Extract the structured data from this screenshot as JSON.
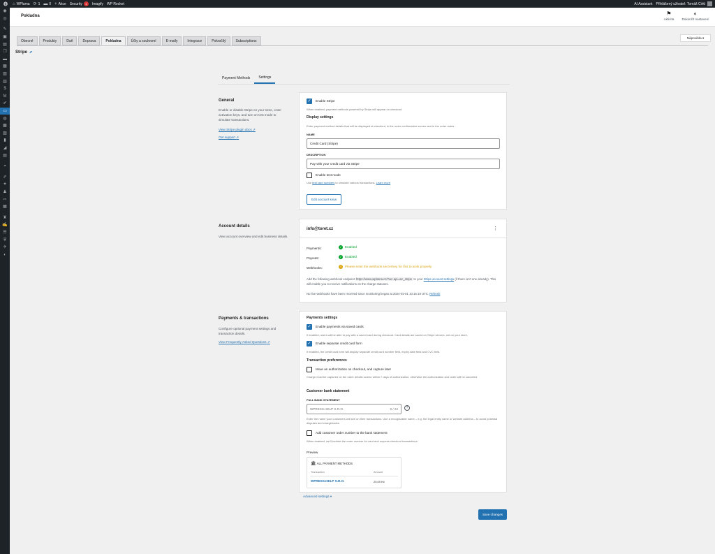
{
  "adminbar": {
    "site_name": "WPlama",
    "updates": "1",
    "comments": "0",
    "new_label": "Akce",
    "security_label": "Security",
    "security_badge": "1",
    "imagify_label": "Imagify",
    "wprocket_label": "WP Rocket",
    "ai_label": "AI Assistant",
    "user_label": "Přihlášený uživatel: Tomáš Cirkl"
  },
  "header": {
    "title": "Pokladna",
    "activity_label": "Aktivita",
    "finish_label": "Dokončit nastavení",
    "help_label": "Nápověda"
  },
  "tabs": [
    "Obecné",
    "Produkty",
    "Daň",
    "Doprava",
    "Pokladna",
    "Účty a soukromí",
    "E-maily",
    "Integrace",
    "Pokročilý",
    "Subscriptions"
  ],
  "active_tab": "Pokladna",
  "page_heading": "Stripe",
  "subtabs": [
    "Payment Methods",
    "Settings"
  ],
  "general": {
    "title": "General",
    "desc": "Enable or disable Stripe on your store, enter activation keys, and turn on test mode to simulate transactions.",
    "link_docs": "View Stripe plugin docs",
    "link_support": "Get support",
    "enable_label": "Enable Stripe",
    "enable_help": "When enabled, payment methods powered by Stripe will appear on checkout.",
    "display_title": "Display settings",
    "display_help": "Enter payment method details that will be displayed at checkout, in the order confirmation screen and in the order notes.",
    "name_label": "NAME",
    "name_value": "Credit Card (Stripe)",
    "desc_label": "DESCRIPTION",
    "desc_value": "Pay with your credit card via Stripe",
    "testmode_label": "Enable test mode",
    "testmode_help_pre": "Use",
    "testmode_help_link": "test card numbers",
    "testmode_help_mid": "to simulate various transactions.",
    "testmode_help_learn": "Learn more",
    "edit_keys_label": "Edit account keys"
  },
  "account": {
    "title": "Account details",
    "desc": "View account overview and edit business details.",
    "email": "info@toret.cz",
    "payments_label": "Payments:",
    "payments_status": "Enabled",
    "payouts_label": "Payouts:",
    "payouts_status": "Enabled",
    "webhooks_label": "Webhooks:",
    "webhooks_status": "Please enter the webhook secret key for this to work properly",
    "endpoint_pre": "Add the following webhook endpoint",
    "endpoint_url": "https://www.wplama.cz/?wc-api=wc_stripe",
    "endpoint_mid": "to your",
    "endpoint_link": "Stripe account settings",
    "endpoint_post": "(if there isn't one already). This will enable you to receive notifications on the charge statuses.",
    "no_webhooks": "No live webhooks have been received since monitoring began at 2024-02-01 10:16:19 UTC.",
    "refresh": "Refresh"
  },
  "payments": {
    "title": "Payments & transactions",
    "desc": "Configure optional payment settings and transaction details.",
    "faq_link": "View Frequently Asked Questions",
    "settings_title": "Payments settings",
    "saved_cards_label": "Enable payments via saved cards",
    "saved_cards_help": "If enabled, users will be able to pay with a saved card during checkout. Card details are saved on Stripe servers, not on your store.",
    "separate_form_label": "Enable separate credit card form",
    "separate_form_help": "If enabled, the credit card form will display separate credit card number field, expiry date field and CVC field.",
    "tx_pref_title": "Transaction preferences",
    "auth_label": "Issue an authorization on checkout, and capture later",
    "auth_help": "Charge must be captured on the order details screen within 7 days of authorization, otherwise the authorization and order will be canceled.",
    "bank_title": "Customer bank statement",
    "full_bank_label": "FULL BANK STATEMENT",
    "bank_value": "WPRESS.HELP S.R.O.",
    "bank_counter": "9 / 22",
    "bank_help": "Enter the name your customers will see on their transactions. Use a recognizable name – e.g. the legal entity name or website address – to avoid potential disputes and chargebacks.",
    "add_order_label": "Add customer order number to the bank statement",
    "add_order_help": "When enabled, we'll include the order number for card and express checkout transactions.",
    "preview_label": "Preview",
    "preview_heading": "ALL PAYMENT METHODS",
    "preview_col_tx": "Transaction",
    "preview_col_amount": "Amount",
    "preview_tx": "WPRESS.HELP S.R.O.",
    "preview_amount": "20,00 Kč"
  },
  "advanced_link": "Advanced settings",
  "save_label": "Save changes"
}
